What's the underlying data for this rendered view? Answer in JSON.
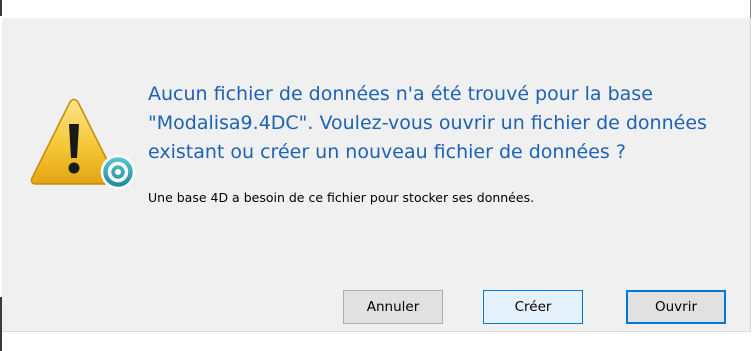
{
  "dialog": {
    "message": "Aucun fichier de données n'a été trouvé pour la base \"Modalisa9.4DC\". Voulez-vous ouvrir un fichier de données existant ou créer un nouveau fichier de données ?",
    "detail": "Une base 4D a besoin de ce fichier pour stocker ses données.",
    "icon": "warning-icon",
    "buttons": {
      "cancel_label": "Annuler",
      "create_label": "Créer",
      "open_label": "Ouvrir"
    }
  },
  "colors": {
    "message_text": "#1d62b5",
    "dialog_background": "#f0f0f0",
    "button_background": "#e1e1e1",
    "button_hover_background": "#e5f1fb",
    "accent_border": "#0078d7",
    "warning_yellow": "#f6c736",
    "badge_teal": "#2a9fb0"
  }
}
